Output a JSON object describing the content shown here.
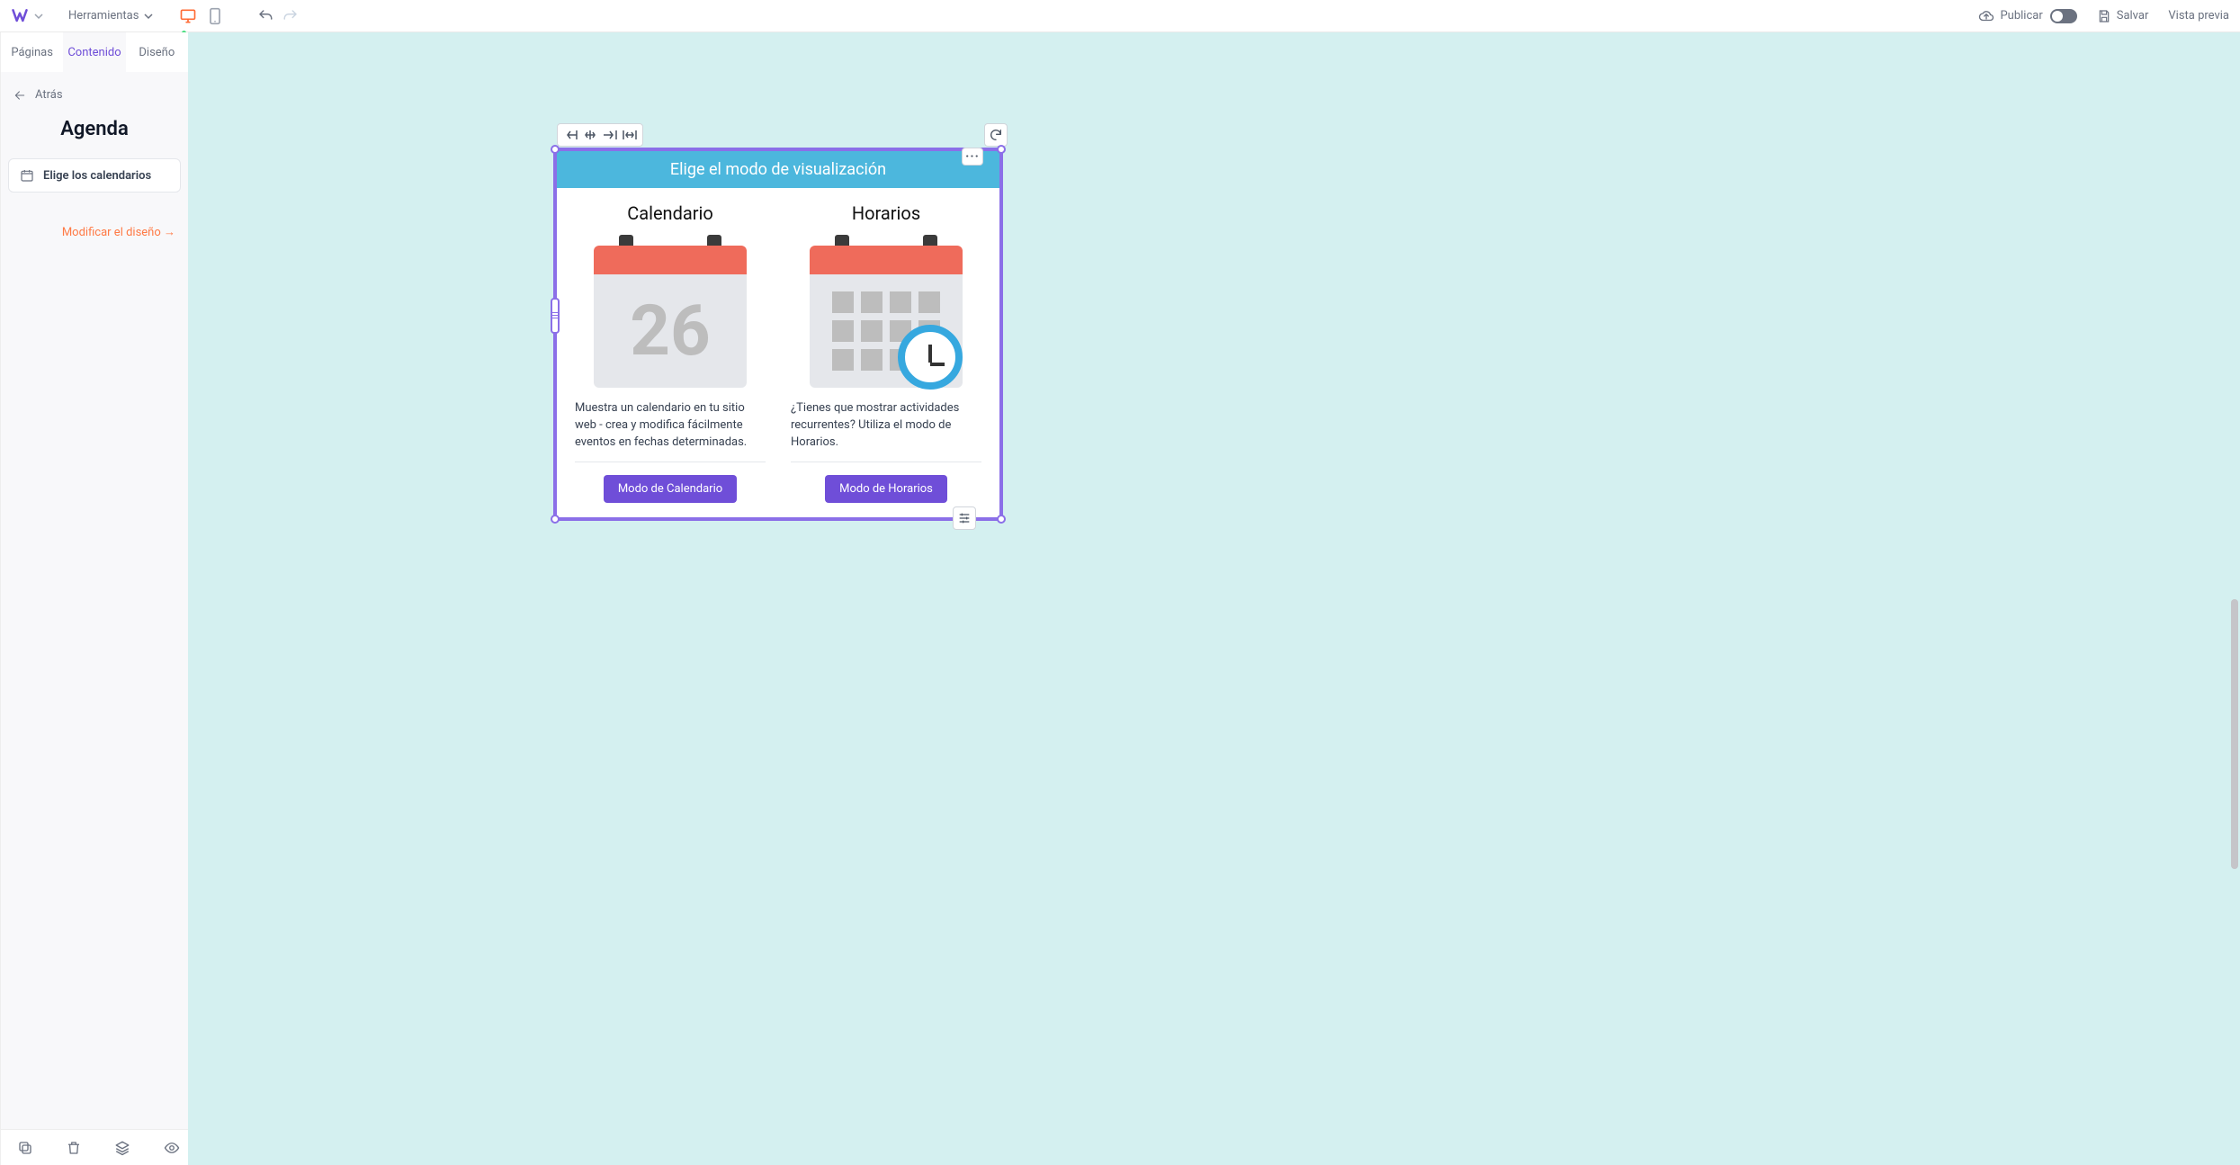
{
  "topbar": {
    "tools_label": "Herramientas",
    "publish_label": "Publicar",
    "save_label": "Salvar",
    "preview_label": "Vista previa"
  },
  "sidebar": {
    "tabs": {
      "pages": "Páginas",
      "content": "Contenido",
      "design": "Diseño"
    },
    "back_label": "Atrás",
    "panel_title": "Agenda",
    "choose_calendars": "Elige los calendarios",
    "modify_design": "Modificar el diseño →"
  },
  "widget": {
    "header": "Elige el modo de visualización",
    "calendar": {
      "title": "Calendario",
      "day": "26",
      "desc": "Muestra un calendario en tu sitio web - crea y modifica fácilmente eventos en fechas determinadas.",
      "button": "Modo de Calendario"
    },
    "schedule": {
      "title": "Horarios",
      "desc": "¿Tienes que mostrar actividades recurrentes? Utiliza el modo de Horarios.",
      "button": "Modo de Horarios"
    }
  }
}
